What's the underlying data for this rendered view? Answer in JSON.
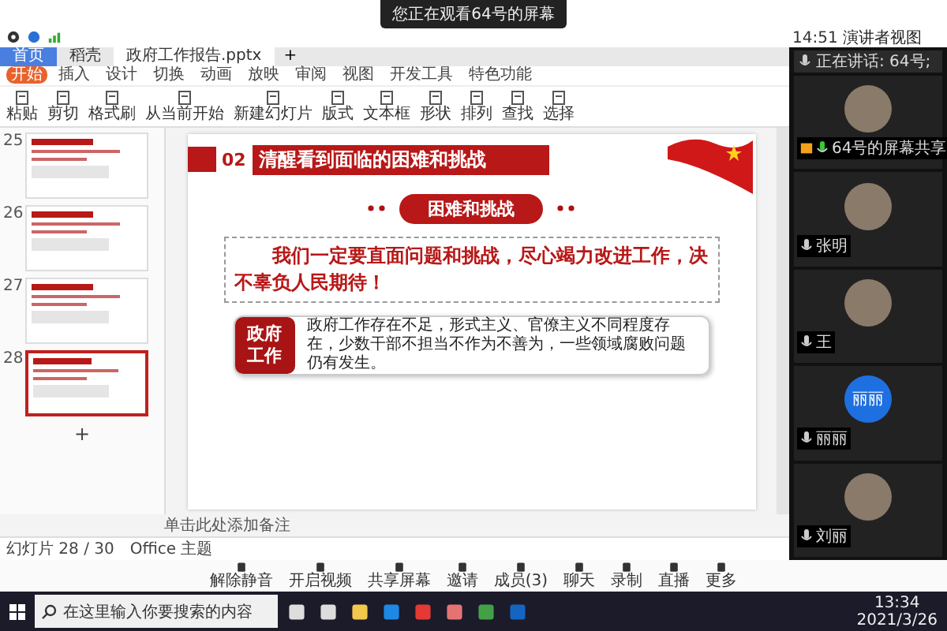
{
  "banner": {
    "text": "您正在观看64号的屏幕"
  },
  "meeting_header": {
    "time": "14:51",
    "view_button": "演讲者视图"
  },
  "app_tabs": [
    {
      "label": "首页",
      "selected": false
    },
    {
      "label": "稻壳",
      "selected": false
    },
    {
      "label": "政府工作报告.pptx",
      "selected": true
    }
  ],
  "new_tab_button": "+",
  "add_slide_button": "+",
  "ribbon_tabs": [
    {
      "label": "开始",
      "selected": true
    },
    {
      "label": "插入",
      "selected": false
    },
    {
      "label": "设计",
      "selected": false
    },
    {
      "label": "切换",
      "selected": false
    },
    {
      "label": "动画",
      "selected": false
    },
    {
      "label": "放映",
      "selected": false
    },
    {
      "label": "审阅",
      "selected": false
    },
    {
      "label": "视图",
      "selected": false
    },
    {
      "label": "开发工具",
      "selected": false
    },
    {
      "label": "特色功能",
      "selected": false
    }
  ],
  "ribbon_tools": [
    "粘贴",
    "剪切",
    "格式刷",
    "从当前开始",
    "新建幻灯片",
    "版式",
    "文本框",
    "形状",
    "排列",
    "查找",
    "选择"
  ],
  "thumbnails": [
    {
      "number": "25",
      "selected": false
    },
    {
      "number": "26",
      "selected": false
    },
    {
      "number": "27",
      "selected": false
    },
    {
      "number": "28",
      "selected": true
    }
  ],
  "slide": {
    "number": "02",
    "title": "清醒看到面临的困难和挑战",
    "pill": "困难和挑战",
    "statement": "我们一定要直面问题和挑战，尽心竭力改进工作，决不辜负人民期待！",
    "card_label": "政府工作",
    "card_text": "政府工作存在不足，形式主义、官僚主义不同程度存在，少数干部不担当不作为不善为，一些领域腐败问题仍有发生。"
  },
  "notes_placeholder": "单击此处添加备注",
  "status_bar": {
    "slide_count": "幻灯片 28 / 30",
    "theme": "Office 主题"
  },
  "participants": {
    "speaking": "正在讲话: 64号;",
    "tiles": [
      {
        "kind": "photo",
        "name": "64号的屏幕共享",
        "sharing": true
      },
      {
        "kind": "photo",
        "name": "张明",
        "sharing": false
      },
      {
        "kind": "photo",
        "name": "王",
        "sharing": false
      },
      {
        "kind": "initials",
        "initials": "丽丽",
        "name": "丽丽",
        "sharing": false
      },
      {
        "kind": "photo",
        "name": "刘丽",
        "sharing": false
      }
    ]
  },
  "meeting_toolbar": [
    "解除静音",
    "开启视频",
    "共享屏幕",
    "邀请",
    "成员(3)",
    "聊天",
    "录制",
    "直播",
    "更多"
  ],
  "taskbar": {
    "search_placeholder": "在这里输入你要搜索的内容",
    "time": "13:34",
    "date": "2021/3/26"
  }
}
